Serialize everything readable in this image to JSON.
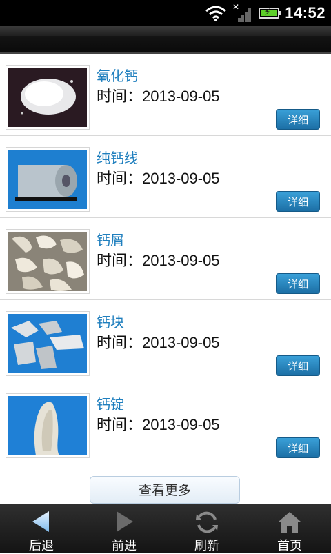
{
  "status_bar": {
    "time": "14:52",
    "icons": [
      "wifi-icon",
      "signal-icon",
      "battery-charging-icon"
    ]
  },
  "products": [
    {
      "name": "氧化钙",
      "time": "时间：2013-09-05",
      "detail_label": "详细",
      "image": "white-calcium-oxide-powder"
    },
    {
      "name": "纯钙线",
      "time": "时间：2013-09-05",
      "detail_label": "详细",
      "image": "cored-wire-coil"
    },
    {
      "name": "钙屑",
      "time": "时间：2013-09-05",
      "detail_label": "详细",
      "image": "calcium-chips"
    },
    {
      "name": "钙块",
      "time": "时间：2013-09-05",
      "detail_label": "详细",
      "image": "calcium-lumps"
    },
    {
      "name": "钙锭",
      "time": "时间：2013-09-05",
      "detail_label": "详细",
      "image": "calcium-ingot"
    }
  ],
  "more_button": "查看更多",
  "bottom_nav": [
    {
      "label": "后退",
      "icon": "back-arrow-icon"
    },
    {
      "label": "前进",
      "icon": "forward-arrow-icon"
    },
    {
      "label": "刷新",
      "icon": "refresh-icon"
    },
    {
      "label": "首页",
      "icon": "home-icon"
    }
  ],
  "colors": {
    "title": "#1f7fbe",
    "detail_button": "#2a88c4",
    "status_bar": "#000000",
    "battery_fill": "#5ecf2a"
  }
}
